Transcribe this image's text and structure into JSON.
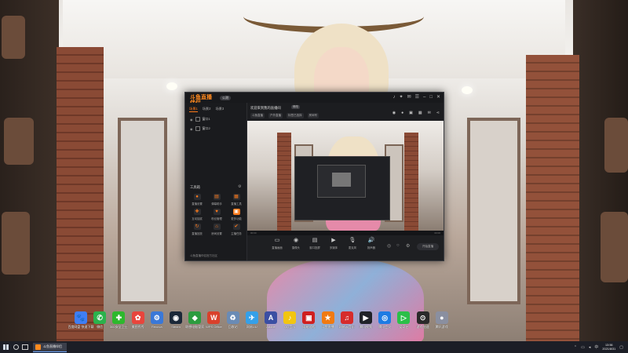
{
  "desktop": {
    "icons": [
      {
        "label": "百度网盘\n快速下载",
        "icon": "baidu-netdisk-icon",
        "color": "#3f7ef5",
        "glyph": "🐾"
      },
      {
        "label": "微信",
        "icon": "wechat-icon",
        "color": "#2bb24c",
        "glyph": "✆"
      },
      {
        "label": "360安全卫士",
        "icon": "360-security-icon",
        "color": "#2db82d",
        "glyph": "✚"
      },
      {
        "label": "美图秀秀",
        "icon": "meitu-icon",
        "color": "#e8453c",
        "glyph": "✿"
      },
      {
        "label": "Recuva",
        "icon": "recovery-icon",
        "color": "#3a78d8",
        "glyph": "⚙"
      },
      {
        "label": "Steam",
        "icon": "steam-icon",
        "color": "#1b2838",
        "glyph": "◉"
      },
      {
        "label": "联想电脑管家",
        "icon": "lenovo-manager-icon",
        "color": "#2c9c3f",
        "glyph": "◆"
      },
      {
        "label": "WPS Office",
        "icon": "wps-icon",
        "color": "#d9402b",
        "glyph": "W"
      },
      {
        "label": "回收站",
        "icon": "recycle-bin-icon",
        "color": "#6a8bb5",
        "glyph": "♻"
      },
      {
        "label": "网易UU",
        "icon": "uu-accelerator-icon",
        "color": "#35a0e8",
        "glyph": "✈"
      },
      {
        "label": "Adobe",
        "icon": "adobe-icon",
        "color": "#3b4fa3",
        "glyph": "A"
      },
      {
        "label": "QQ音乐",
        "icon": "qq-music-icon",
        "color": "#f2c511",
        "glyph": "♪"
      },
      {
        "label": "网易游戏",
        "icon": "netease-game-icon",
        "color": "#cf1f1f",
        "glyph": "▣"
      },
      {
        "label": "斗鱼直播",
        "icon": "douyu-icon",
        "color": "#f07a12",
        "glyph": "★"
      },
      {
        "label": "网易云音乐",
        "icon": "netease-music-icon",
        "color": "#d62b2b",
        "glyph": "♫"
      },
      {
        "label": "腾讯视频",
        "icon": "tencent-video-icon",
        "color": "#202228",
        "glyph": "▶"
      },
      {
        "label": "腾讯会议",
        "icon": "tencent-meeting-icon",
        "color": "#1e7be3",
        "glyph": "◎"
      },
      {
        "label": "爱奇艺",
        "icon": "iqiyi-icon",
        "color": "#2bbf49",
        "glyph": "▷"
      },
      {
        "label": "游戏加速",
        "icon": "game-booster-icon",
        "color": "#2a2a2a",
        "glyph": "⊙"
      },
      {
        "label": "腾讯游戏",
        "icon": "tencent-game-icon",
        "color": "#8a8fa0",
        "glyph": "●"
      }
    ]
  },
  "app": {
    "logo": "斗鱼直播伴侣",
    "version": "公测",
    "window_controls": [
      "bell-icon",
      "skin-icon",
      "mail-icon",
      "menu-icon",
      "minimize-icon",
      "maximize-icon",
      "close-icon"
    ],
    "tabs": [
      {
        "label": "场景1",
        "active": true
      },
      {
        "label": "场景2",
        "active": false
      },
      {
        "label": "场景3",
        "active": false
      }
    ],
    "scenes": [
      {
        "name": "窗口1"
      },
      {
        "name": "窗口2"
      }
    ],
    "tools_title": "工具箱",
    "tools": [
      {
        "label": "直播设置",
        "icon": "camera-icon"
      },
      {
        "label": "弹幕助手",
        "icon": "danmaku-icon"
      },
      {
        "label": "直播工具",
        "icon": "live-tool-icon"
      },
      {
        "label": "互动抽奖",
        "icon": "lottery-icon"
      },
      {
        "label": "粉丝管理",
        "icon": "fans-icon"
      },
      {
        "label": "更多功能",
        "icon": "more-icon"
      },
      {
        "label": "直播回放",
        "icon": "replay-icon"
      },
      {
        "label": "房间设置",
        "icon": "room-icon"
      },
      {
        "label": "主播任务",
        "icon": "task-icon"
      }
    ],
    "left_footer": "斗鱼直播伴侣官方社区",
    "room_title": "欢迎来到我的直播间",
    "edit_label": "修改",
    "tags": [
      "斗鱼直播",
      "户外直播",
      "标签已选择",
      "房间号"
    ],
    "top_icons": [
      "camera-top-icon",
      "mic-top-icon",
      "record-top-icon",
      "layout-icon",
      "gift-icon",
      "share-icon"
    ],
    "timeline_labels": [
      "00:00",
      "00:00"
    ],
    "bottom_tools": [
      {
        "label": "直播画面",
        "icon": "screen-icon",
        "glyph": "▭"
      },
      {
        "label": "摄像头",
        "icon": "webcam-icon",
        "glyph": "◉"
      },
      {
        "label": "窗口投屏",
        "icon": "window-cast-icon",
        "glyph": "▤"
      },
      {
        "label": "多媒体",
        "icon": "media-icon",
        "glyph": "▶"
      },
      {
        "label": "麦克风",
        "icon": "microphone-icon",
        "glyph": "🎙"
      },
      {
        "label": "扬声器",
        "icon": "speaker-icon",
        "glyph": "🔊"
      }
    ],
    "start_live": "开始直播"
  },
  "taskbar": {
    "app_label": "斗鱼直播伴侣",
    "time": "13:56",
    "date": "2021/8/31"
  }
}
